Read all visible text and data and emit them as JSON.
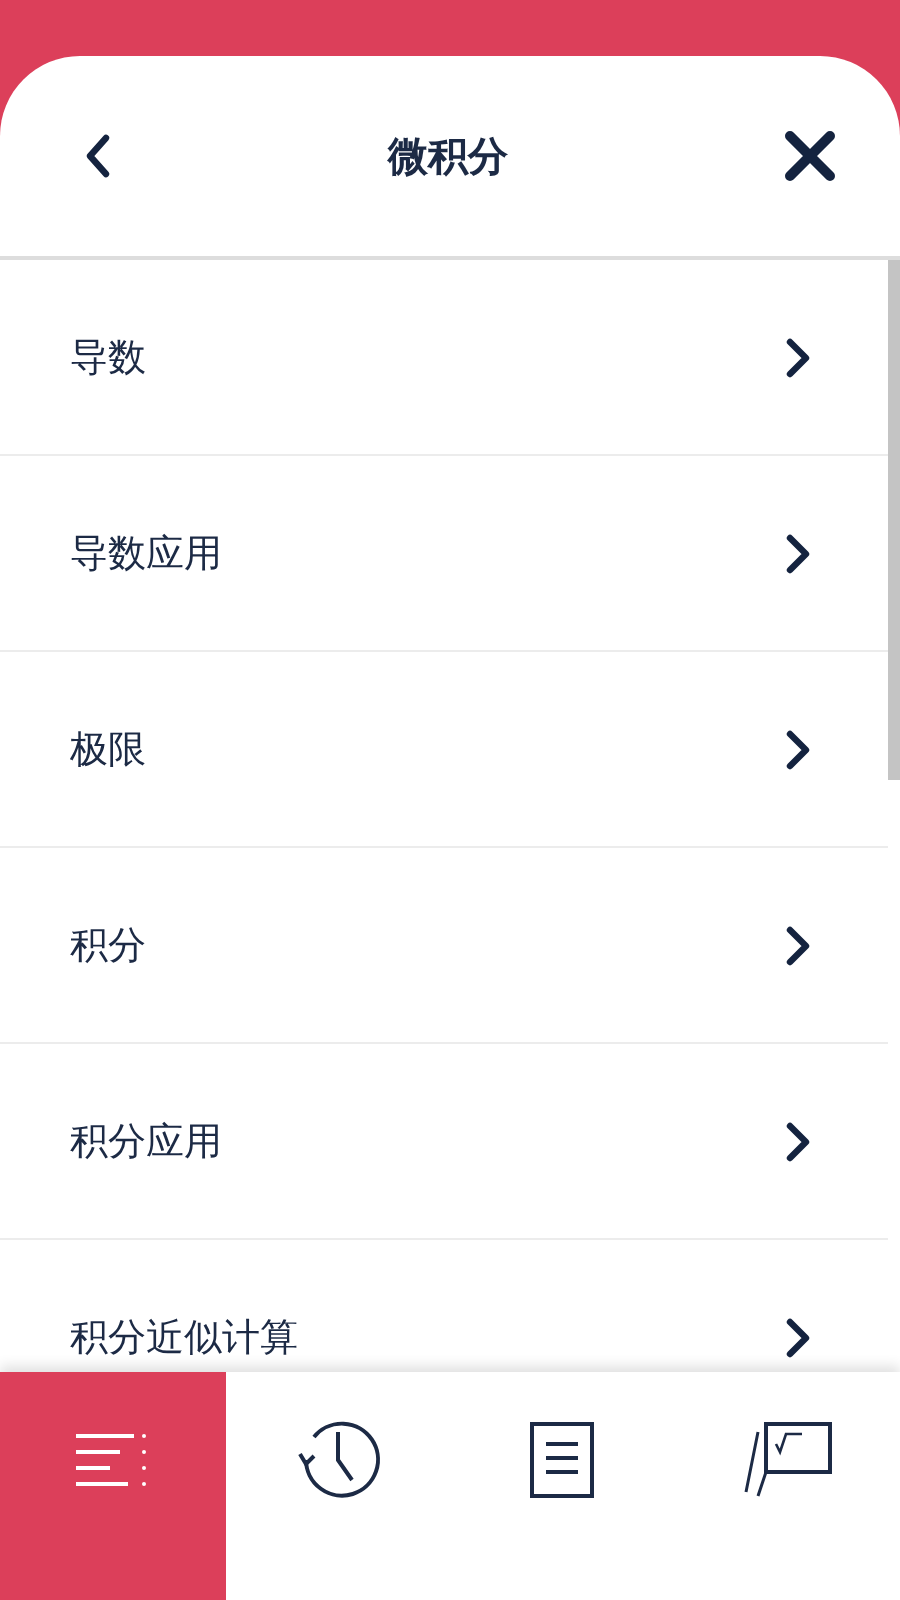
{
  "header": {
    "title": "微积分"
  },
  "items": [
    {
      "label": "导数"
    },
    {
      "label": "导数应用"
    },
    {
      "label": "极限"
    },
    {
      "label": "积分"
    },
    {
      "label": "积分应用"
    },
    {
      "label": "积分近似计算"
    }
  ],
  "tabs": [
    {
      "kind": "menu",
      "selected": true
    },
    {
      "kind": "history",
      "selected": false
    },
    {
      "kind": "notes",
      "selected": false
    },
    {
      "kind": "formulas",
      "selected": false
    }
  ]
}
